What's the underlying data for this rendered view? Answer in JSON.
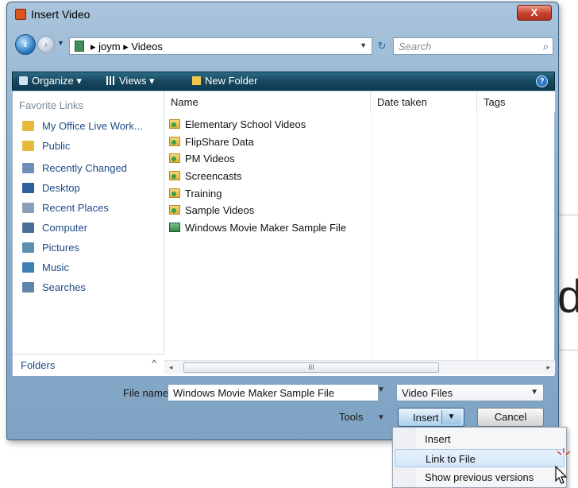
{
  "window": {
    "title": "Insert Video",
    "close_label": "X"
  },
  "address": {
    "path": "▸ joym ▸ Videos",
    "search_placeholder": "Search"
  },
  "toolbar": {
    "organize_label": "Organize ▾",
    "views_label": "Views ▾",
    "new_folder_label": "New Folder",
    "help_label": "?"
  },
  "nav": {
    "header": "Favorite Links",
    "items": [
      {
        "label": "My Office Live Work...",
        "icon": "folder-icon",
        "color": "#e6b93a"
      },
      {
        "label": "Public",
        "icon": "folder-icon",
        "color": "#e6b93a"
      },
      {
        "label": "Recently Changed",
        "icon": "recent-icon",
        "color": "#6f8fb8"
      },
      {
        "label": "Desktop",
        "icon": "desktop-icon",
        "color": "#2e5e9e"
      },
      {
        "label": "Recent Places",
        "icon": "places-icon",
        "color": "#8aa0b8"
      },
      {
        "label": "Computer",
        "icon": "computer-icon",
        "color": "#4a6f98"
      },
      {
        "label": "Pictures",
        "icon": "pictures-icon",
        "color": "#5f8fb0"
      },
      {
        "label": "Music",
        "icon": "music-icon",
        "color": "#3f7fb8"
      },
      {
        "label": "Searches",
        "icon": "search-folder-icon",
        "color": "#5f83aa"
      }
    ],
    "folders_label": "Folders",
    "folders_chevron": "^"
  },
  "files": {
    "columns": [
      "Name",
      "Date taken",
      "Tags"
    ],
    "rows": [
      {
        "name": "Elementary School Videos",
        "type": "folder"
      },
      {
        "name": "FlipShare Data",
        "type": "folder"
      },
      {
        "name": "PM Videos",
        "type": "folder"
      },
      {
        "name": "Screencasts",
        "type": "folder"
      },
      {
        "name": "Training",
        "type": "folder"
      },
      {
        "name": "Sample Videos",
        "type": "folder"
      },
      {
        "name": "Windows Movie Maker Sample File",
        "type": "video"
      }
    ],
    "scroll_grip": "III"
  },
  "footer": {
    "file_name_label": "File name:",
    "file_name_value": "Windows Movie Maker Sample File",
    "file_type_value": "Video Files",
    "tools_label": "Tools",
    "insert_label": "Insert",
    "cancel_label": "Cancel"
  },
  "menu": {
    "items": [
      "Insert",
      "Link to File",
      "Show previous versions"
    ],
    "hovered_index": 1
  },
  "background": {
    "letter": "d"
  },
  "colors": {
    "toolbar": "#17485f",
    "link": "#1e4a86",
    "close": "#c7412a"
  }
}
